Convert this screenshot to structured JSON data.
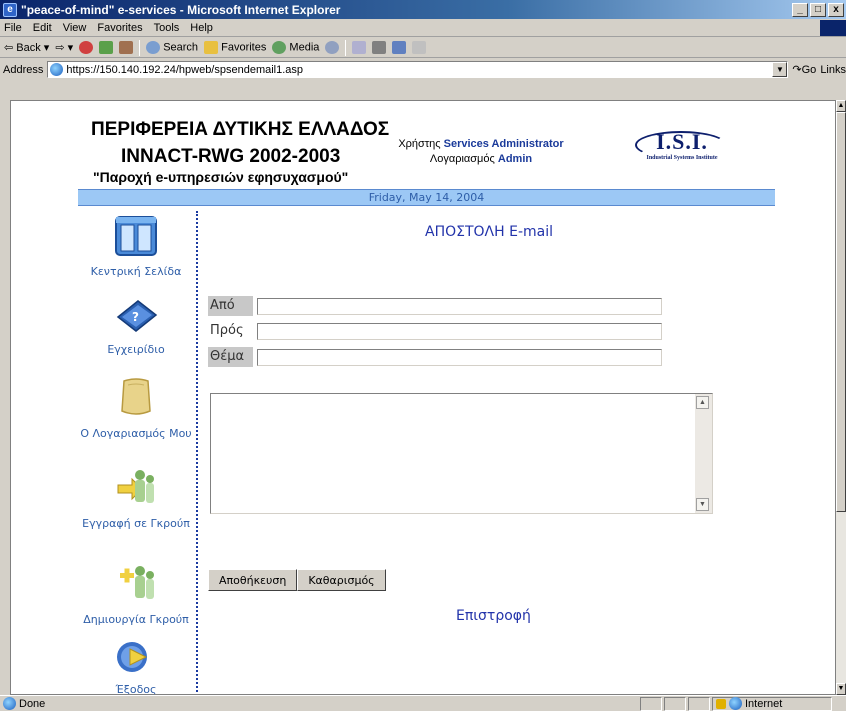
{
  "window": {
    "title": "\"peace-of-mind\" e-services - Microsoft Internet Explorer",
    "icon": "ie-icon"
  },
  "menubar": {
    "items": [
      "File",
      "Edit",
      "View",
      "Favorites",
      "Tools",
      "Help"
    ]
  },
  "toolbar": {
    "back": "Back",
    "search": "Search",
    "favorites": "Favorites",
    "media": "Media"
  },
  "addressbar": {
    "label": "Address",
    "url": "https://150.140.192.24/hpweb/spsendemail1.asp",
    "go": "Go",
    "links": "Links"
  },
  "header": {
    "line1": "ΠΕΡΙΦΕΡΕΙΑ ΔΥΤΙΚΗΣ ΕΛΛΑΔΟΣ",
    "line2": "INNACT-RWG 2002-2003",
    "line3": "\"Παροχή e-υπηρεσιών εφησυχασμού\"",
    "user_label": "Χρήστης",
    "user_name": "Services Administrator",
    "account_label": "Λογαριασμός",
    "account_name": "Admin",
    "logo_text": "I.S.I.",
    "logo_subtitle": "Industrial Systems Institute"
  },
  "datebar": {
    "date": "Friday, May 14, 2004"
  },
  "sidebar": {
    "items": [
      {
        "label": "Κεντρική Σελίδα",
        "icon": "home-book-icon"
      },
      {
        "label": "Εγχειρίδιο",
        "icon": "manual-icon"
      },
      {
        "label": "Ο Λογαριασμός Μου",
        "icon": "account-icon"
      },
      {
        "label": "Εγγραφή σε Γκρούπ",
        "icon": "join-group-icon"
      },
      {
        "label": "Δημιουργία Γκρούπ",
        "icon": "create-group-icon"
      },
      {
        "label": "Έξοδος",
        "icon": "exit-icon"
      }
    ]
  },
  "form": {
    "title": "ΑΠΟΣΤΟΛΗ E-mail",
    "from_label": "Από",
    "from_value": "",
    "to_label": "Πρός",
    "to_value": "",
    "subject_label": "Θέμα",
    "subject_value": "",
    "message_value": "",
    "save_label": "Αποθήκευση",
    "clear_label": "Καθαρισμός",
    "return_label": "Επιστροφή"
  },
  "statusbar": {
    "status": "Done",
    "zone": "Internet"
  },
  "colors": {
    "accent_blue": "#2233aa",
    "link_blue": "#2e5ea8",
    "datebar_bg": "#9cc8f5",
    "titlebar": "#0a246a"
  }
}
